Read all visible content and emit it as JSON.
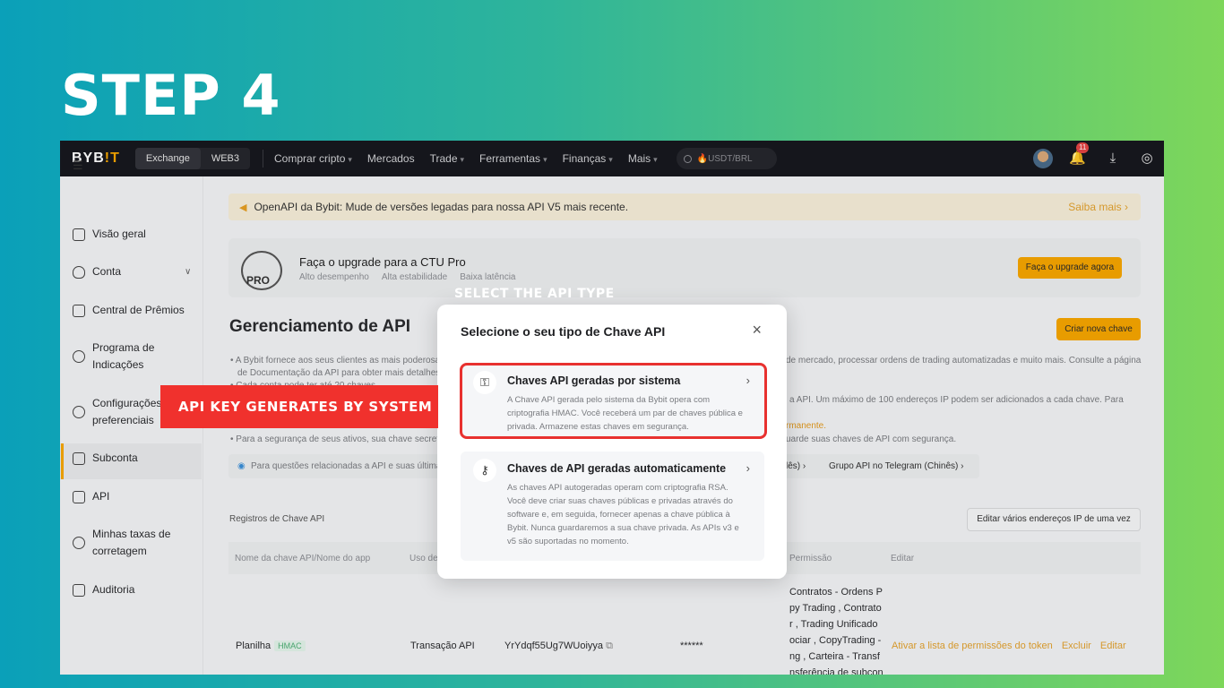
{
  "step_title": "STEP 4",
  "topnav": {
    "logo_main": "BYB",
    "logo_accent": "!T",
    "seg_exchange": "Exchange",
    "seg_web3": "WEB3",
    "items": [
      "Comprar cripto",
      "Mercados",
      "Trade",
      "Ferramentas",
      "Finanças",
      "Mais"
    ],
    "search_placeholder": "🔥USDT/BRL",
    "notif_count": "11"
  },
  "sidebar": {
    "items": [
      {
        "label": "Visão geral"
      },
      {
        "label": "Conta"
      },
      {
        "label": "Central de Prêmios"
      },
      {
        "label": "Programa de\nIndicações"
      },
      {
        "label": "Configurações\npreferenciais"
      },
      {
        "label": "Subconta"
      },
      {
        "label": "API"
      },
      {
        "label": "Minhas taxas de\ncorretagem"
      },
      {
        "label": "Auditoria"
      }
    ]
  },
  "banner": {
    "text": "OpenAPI da Bybit: Mude de versões legadas para nossa API V5 mais recente.",
    "more": "Saiba mais ›"
  },
  "upgrade": {
    "logo_text": "PRO",
    "title": "Faça o upgrade para a CTU Pro",
    "features": [
      "Alto desempenho",
      "Alta estabilidade",
      "Baixa latência"
    ],
    "button": "Faça o upgrade agora"
  },
  "page": {
    "title": "Gerenciamento de API",
    "create_button": "Criar nova chave",
    "info_1a": "• A Bybit fornece aos seus clientes as mais poderosa",
    "info_1b": "de mercado, processar ordens de trading automatizadas e muito mais. Consulte a página",
    "info_2": "de Documentação da API para obter mais detalhes",
    "info_3": "• Cada conta pode ter até 20 chaves",
    "info_4b": "a API. Um máximo de 100 endereços IP podem ser adicionados a cada chave. Para",
    "info_5b": "rmanente.",
    "info_6a": "• Para a segurança de seus ativos, sua chave secreta",
    "info_6b": "uarde suas chaves de API com segurança.",
    "chip_left": "Para questões relacionadas a API e suas última",
    "chip_right1": "lês) ›",
    "chip_right2": "Grupo API no Telegram (Chinês) ›",
    "registros": "Registros de Chave API",
    "edit_ip": "Editar vários endereços IP de uma vez"
  },
  "table": {
    "headers": [
      "Nome da chave API/Nome do app",
      "Uso de",
      "Permissão",
      "Editar"
    ],
    "row": {
      "name": "Planilha",
      "type": "HMAC",
      "usage": "Transação API",
      "key": "YrYdqf55Ug7WUoiyya",
      "secret": "******",
      "permissions": "Contratos - Ordens P\npy Trading , Contrato\nr , Trading Unificado\nociar , CopyTrading -\nng , Carteira - Transf\nnsferência de subcon",
      "actions": [
        "Ativar a lista de permissões do token",
        "Excluir",
        "Editar"
      ]
    }
  },
  "modal": {
    "title": "Selecione o seu tipo de Chave API",
    "option1": {
      "title": "Chaves API geradas por sistema",
      "desc": "A Chave API gerada pelo sistema da Bybit opera com criptografia HMAC. Você receberá um par de chaves pública e privada. Armazene estas chaves em segurança."
    },
    "option2": {
      "title": "Chaves de API geradas automaticamente",
      "desc": "As chaves API autogeradas operam com criptografia RSA. Você deve criar suas chaves públicas e privadas através do software e, em seguida, fornecer apenas a chave pública à Bybit. Nunca guardaremos a sua chave privada. As APIs v3 e v5 são suportadas no momento."
    }
  },
  "annotations": {
    "select_label": "SELECT THE API TYPE",
    "api_label": "API KEY GENERATES BY SYSTEM",
    "highlight_color": "#e8312f"
  },
  "colors": {
    "accent": "#f7a600",
    "nav_bg": "#17181e"
  }
}
